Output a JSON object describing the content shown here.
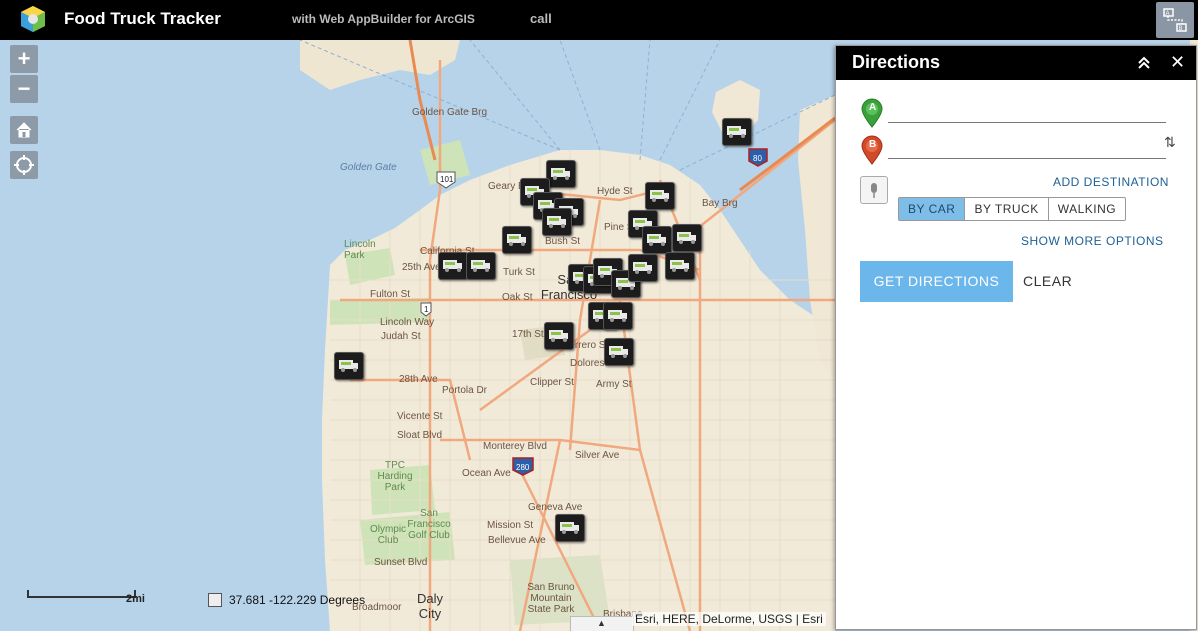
{
  "header": {
    "title": "Food Truck Tracker",
    "subtitle": "with Web AppBuilder for ArcGIS",
    "extra": "call",
    "widget_icon": "directions-widget-icon"
  },
  "map": {
    "water_labels": [
      "Golden Gate"
    ],
    "park_labels": [
      "Lincoln Park",
      "TPC Harding Park",
      "Olympic Club",
      "San Francisco Golf Club",
      "San Bruno Mountain State Park"
    ],
    "city_labels": [
      "San Francisco",
      "Daly City"
    ],
    "street_labels": [
      "Lincoln Way",
      "Judah St",
      "Fulton St",
      "California St",
      "Bush St",
      "Turk St",
      "Oak St",
      "17th St",
      "Clipper St",
      "Sloat Blvd",
      "Vicente St",
      "Ocean Ave",
      "Monterey Blvd",
      "Silver Ave",
      "Mission St",
      "Geneva Ave",
      "Bellevue Ave",
      "Army St",
      "Guerrero St",
      "Dolores St",
      "Broadmoor",
      "Brisbane",
      "Sunset Blvd",
      "25th Ave",
      "Geary Blvd",
      "Hyde St",
      "Pine St",
      "Bay Brg",
      "Golden Gate Brg",
      "Portola Dr",
      "28th Ave"
    ],
    "highway_labels": [
      "101",
      "1",
      "80",
      "280"
    ],
    "truck_count": 25,
    "scale_label": "2mi",
    "coordinates": "37.681  -122.229 Degrees",
    "attribution": "Esri, HERE, DeLorme, USGS | Esri",
    "attribution_toggle": "▲"
  },
  "controls": {
    "zoom_in": "+",
    "zoom_out": "−"
  },
  "directions": {
    "title": "Directions",
    "stop_a_label": "A",
    "stop_b_label": "B",
    "stop_a_value": "",
    "stop_b_value": "",
    "swap_icon": "⇅",
    "add_destination": "ADD DESTINATION",
    "modes": [
      "BY CAR",
      "BY TRUCK",
      "WALKING"
    ],
    "active_mode": "BY CAR",
    "more_options": "SHOW MORE OPTIONS",
    "get_directions": "GET DIRECTIONS",
    "clear": "CLEAR",
    "close": "✕"
  },
  "colors": {
    "header_bg": "#000000",
    "water": "#b7d3ea",
    "land": "#f2ead9",
    "active_mode": "#7fbde9",
    "get_directions": "#6bb6ea",
    "marker_a": "#3aa13a",
    "marker_b": "#d14a2a"
  }
}
